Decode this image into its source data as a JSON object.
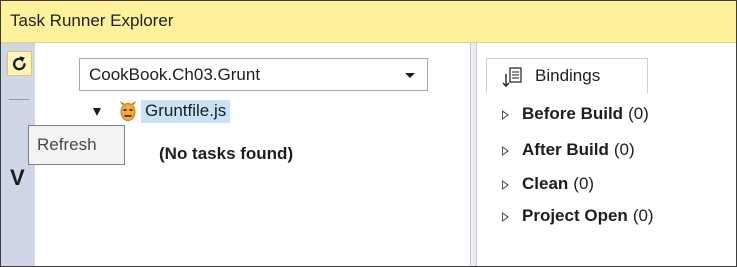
{
  "window": {
    "title": "Task Runner Explorer"
  },
  "toolbar": {
    "refresh_icon": "refresh-icon",
    "side_glyph": "V"
  },
  "tooltip": {
    "text": "Refresh"
  },
  "project_select": {
    "value": "CookBook.Ch03.Grunt"
  },
  "tree": {
    "file_label": "Gruntfile.js",
    "file_icon": "grunt-icon",
    "empty_message": "(No tasks found)"
  },
  "bindings": {
    "tab_label": "Bindings",
    "tab_icon": "bindings-icon",
    "items": [
      {
        "name": "Before Build",
        "count": "(0)"
      },
      {
        "name": "After Build",
        "count": "(0)"
      },
      {
        "name": "Clean",
        "count": "(0)"
      },
      {
        "name": "Project Open",
        "count": "(0)"
      }
    ]
  },
  "colors": {
    "titlebar": "#fff29d",
    "toolstrip": "#cfd6e5",
    "selection": "#c9e2f5",
    "refresh_hover": "#fdf4bf"
  }
}
